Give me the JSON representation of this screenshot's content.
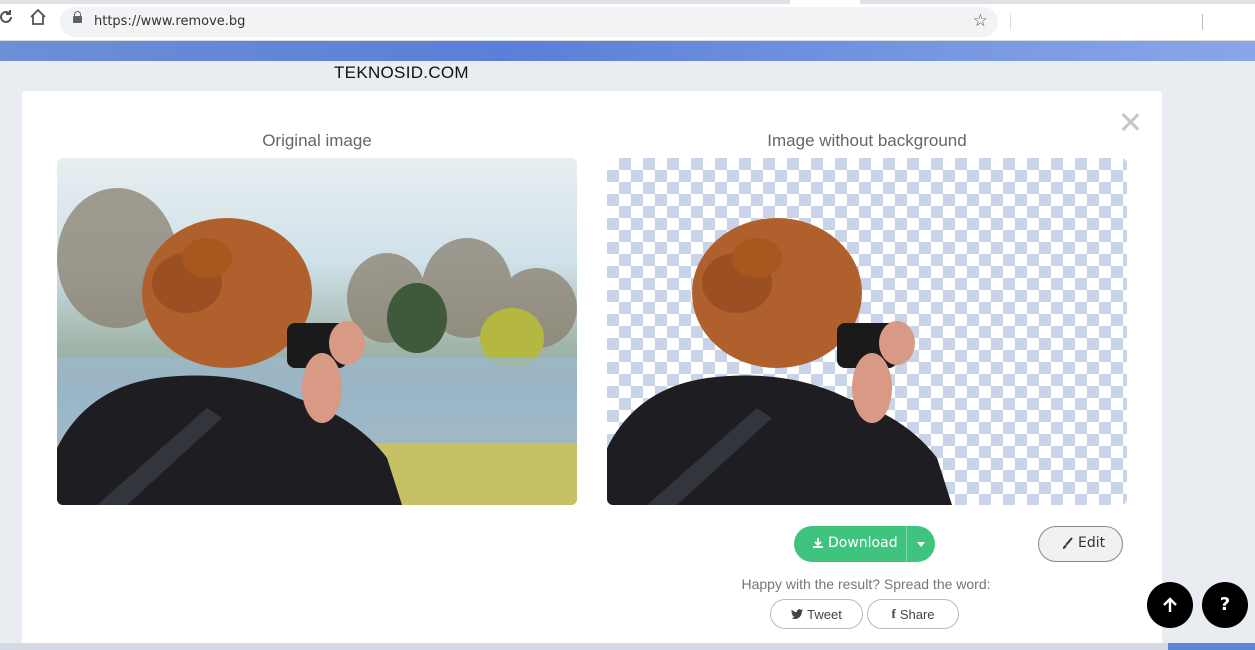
{
  "browser": {
    "url": "https://www.remove.bg",
    "reload_icon": "reload-icon",
    "home_icon": "home-icon",
    "lock_icon": "lock-icon",
    "star_icon": "star-icon"
  },
  "watermark": "TEKNOSID.COM",
  "modal": {
    "original_title": "Original image",
    "result_title": "Image without background",
    "download_label": "Download",
    "edit_label": "Edit",
    "spread_text": "Happy with the result? Spread the word:",
    "tweet_label": "Tweet",
    "share_label": "Share"
  },
  "fab": {
    "scroll_top_icon": "arrow-up-icon",
    "help_label": "?"
  },
  "colors": {
    "accent_green": "#3ec47f",
    "brand_blue": "#5a7fd8"
  }
}
